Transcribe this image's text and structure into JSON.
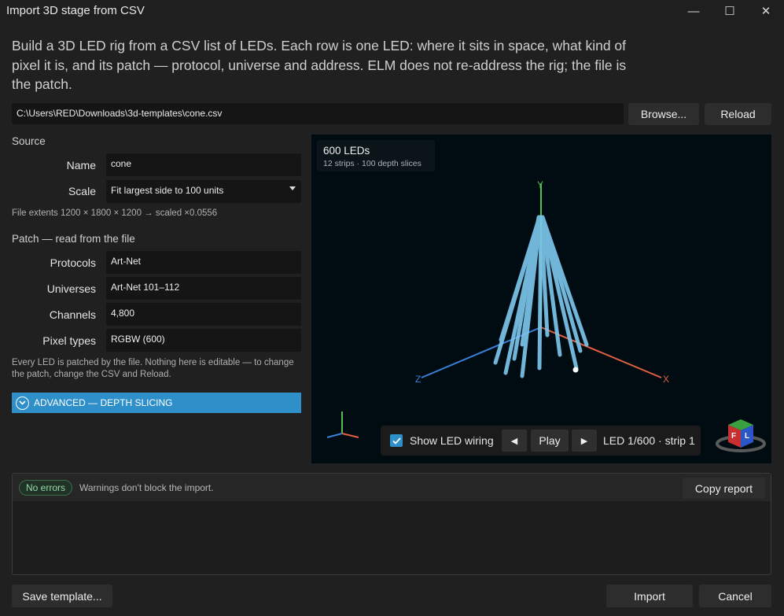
{
  "window": {
    "title": "Import 3D stage from CSV",
    "minimize_glyph": "—",
    "maximize_glyph": "☐",
    "close_glyph": "✕"
  },
  "intro": "Build a 3D LED rig from a CSV list of LEDs. Each row is one LED: where it sits in space, what kind of pixel it is, and its patch — protocol, universe and address. ELM does not re-address the rig; the file is the patch.",
  "file": {
    "path": "C:\\Users\\RED\\Downloads\\3d-templates\\cone.csv",
    "browse_label": "Browse...",
    "reload_label": "Reload"
  },
  "source": {
    "heading": "Source",
    "name_label": "Name",
    "name_value": "cone",
    "scale_label": "Scale",
    "scale_value": "Fit largest side to 100 units",
    "extents": "File extents 1200 × 1800 × 1200 → scaled ×0.0556"
  },
  "patch": {
    "heading": "Patch — read from the file",
    "protocols_label": "Protocols",
    "protocols_value": "Art-Net",
    "universes_label": "Universes",
    "universes_value": "Art-Net 101–112",
    "channels_label": "Channels",
    "channels_value": "4,800",
    "pixel_types_label": "Pixel types",
    "pixel_types_value": "RGBW (600)",
    "note": "Every LED is patched by the file. Nothing here is editable — to change the patch, change the CSV and Reload."
  },
  "advanced": {
    "label": "ADVANCED — DEPTH SLICING",
    "icon": "chevron-down-circle-icon"
  },
  "viewport": {
    "led_count": "600 LEDs",
    "led_detail": "12 strips · 100 depth slices",
    "axis_x": "X",
    "axis_y": "Y",
    "axis_z": "Z",
    "cube_f": "F",
    "cube_l": "L",
    "show_wiring_label": "Show LED wiring",
    "show_wiring_checked": true,
    "prev_glyph": "◀",
    "play_label": "Play",
    "next_glyph": "▶",
    "led_status": "LED 1/600 · strip 1"
  },
  "log": {
    "badge": "No errors",
    "message": "Warnings don't block the import.",
    "copy_label": "Copy report"
  },
  "footer": {
    "save_template_label": "Save template...",
    "import_label": "Import",
    "cancel_label": "Cancel"
  },
  "colors": {
    "accent": "#2f8fc9",
    "led": "#7ec8ee",
    "axis_x": "#e06040",
    "axis_y": "#50c050",
    "axis_z": "#3a7fd8"
  }
}
